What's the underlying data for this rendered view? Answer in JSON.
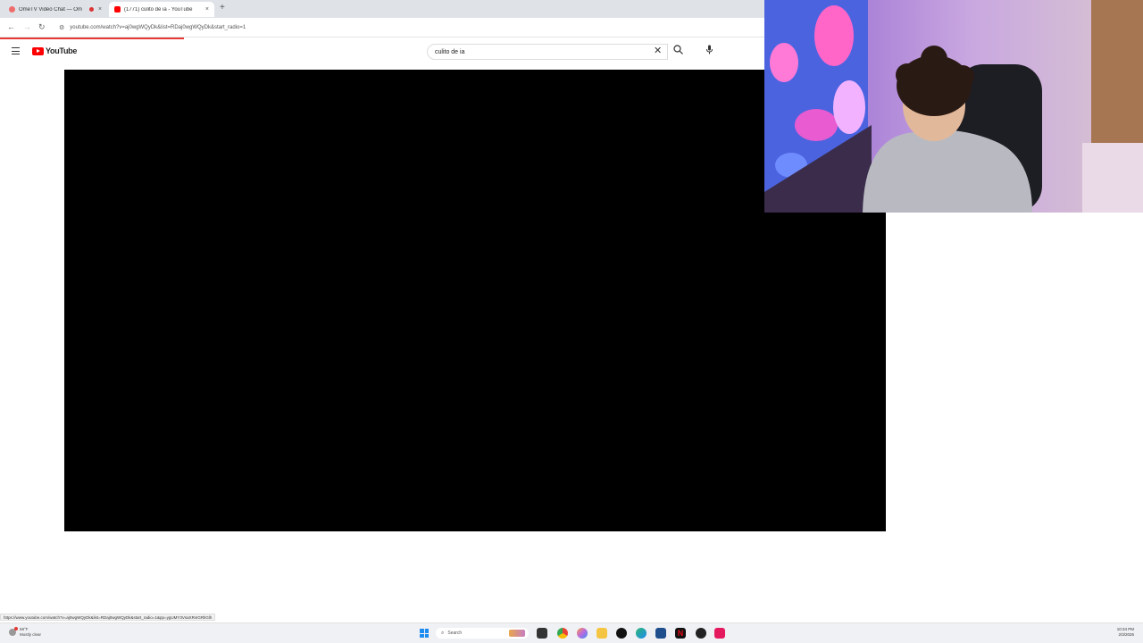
{
  "browser": {
    "tabs": [
      {
        "title": "OmeTV Video Chat — Om",
        "active": false
      },
      {
        "title": "(1771) culito de ia - YouTube",
        "active": true
      }
    ],
    "new_tab": "+",
    "close": "×",
    "url": "youtube.com/watch?v=aj0wgWQyDk&list=RDaj0wgWQyDk&start_radio=1"
  },
  "youtube": {
    "logo_text": "YouTube",
    "search_value": "culito de ia"
  },
  "status_url": "https://www.youtube.com/watch?v=aj0wgWQyDk&list=RDaj0wgWQyDk&start_radio=1&pp=ygUMY3VsaXRvIGRlIGlh",
  "taskbar": {
    "weather_temp": "58°F",
    "weather_desc": "Mostly clear",
    "search_label": "Search",
    "time": "10:34 PM",
    "date": "2/3/2026"
  },
  "colors": {
    "youtube_red": "#ff0000",
    "player_bg": "#000000",
    "windows_blue": "#1d8cf0"
  }
}
